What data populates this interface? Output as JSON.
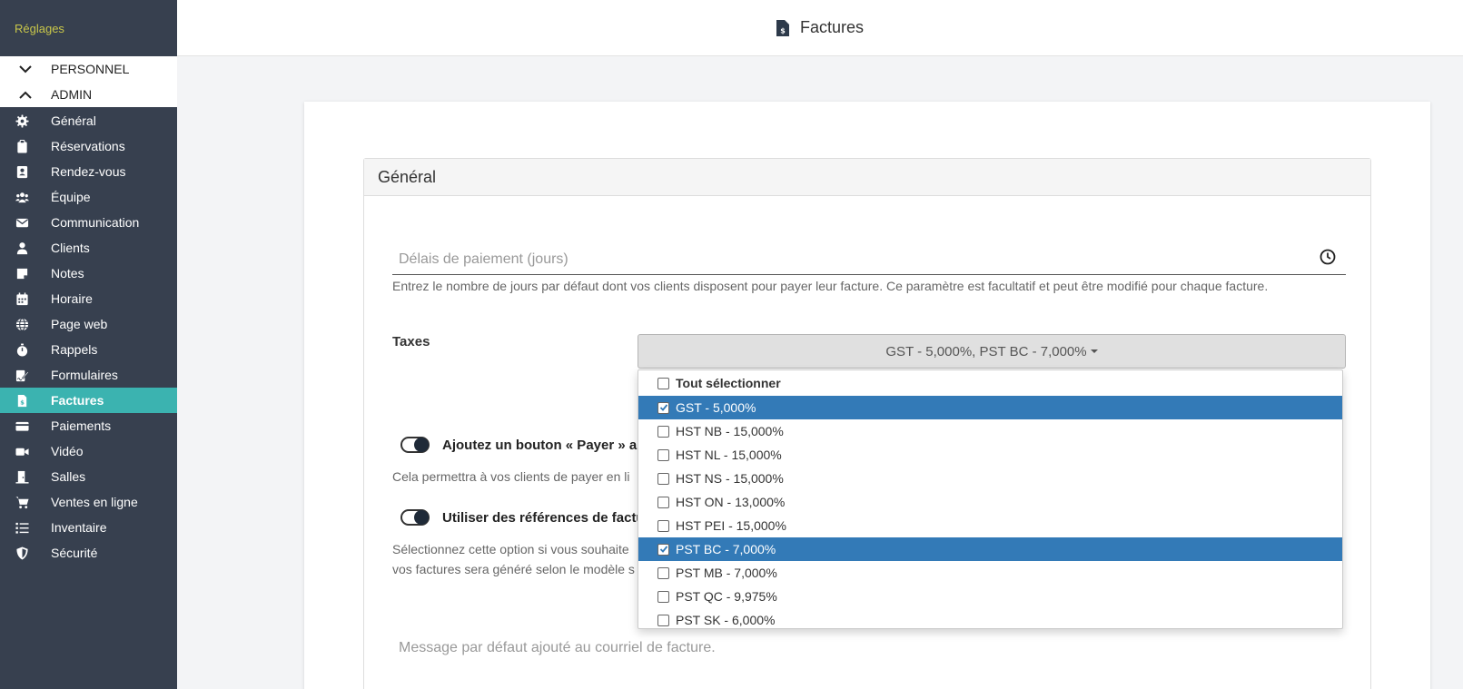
{
  "sidebar": {
    "heading": "Réglages",
    "sections": [
      {
        "label": "PERSONNEL",
        "state": "collapsed"
      },
      {
        "label": "ADMIN",
        "state": "expanded"
      }
    ],
    "items": [
      {
        "label": "Général",
        "icon": "gear-icon"
      },
      {
        "label": "Réservations",
        "icon": "clipboard-icon"
      },
      {
        "label": "Rendez-vous",
        "icon": "contact-card-icon"
      },
      {
        "label": "Équipe",
        "icon": "users-icon"
      },
      {
        "label": "Communication",
        "icon": "envelope-icon"
      },
      {
        "label": "Clients",
        "icon": "user-icon"
      },
      {
        "label": "Notes",
        "icon": "sticky-note-icon"
      },
      {
        "label": "Horaire",
        "icon": "calendar-icon"
      },
      {
        "label": "Page web",
        "icon": "globe-icon"
      },
      {
        "label": "Rappels",
        "icon": "stopwatch-icon"
      },
      {
        "label": "Formulaires",
        "icon": "signature-icon"
      },
      {
        "label": "Factures",
        "icon": "invoice-icon",
        "active": true
      },
      {
        "label": "Paiements",
        "icon": "credit-card-icon"
      },
      {
        "label": "Vidéo",
        "icon": "video-icon"
      },
      {
        "label": "Salles",
        "icon": "door-icon"
      },
      {
        "label": "Ventes en ligne",
        "icon": "cart-icon"
      },
      {
        "label": "Inventaire",
        "icon": "list-icon"
      },
      {
        "label": "Sécurité",
        "icon": "shield-icon"
      }
    ]
  },
  "header": {
    "title": "Factures",
    "icon": "invoice-icon"
  },
  "panel": {
    "title": "Général",
    "payment_delay": {
      "placeholder": "Délais de paiement (jours)",
      "value": "",
      "help": "Entrez le nombre de jours par défaut dont vos clients disposent pour payer leur facture. Ce paramètre est facultatif et peut être modifié pour chaque facture."
    },
    "taxes": {
      "label": "Taxes",
      "selected_text": "GST - 5,000%, PST BC - 7,000%"
    },
    "pay_button_toggle": {
      "label": "Ajoutez un bouton « Payer » aux",
      "help": "Cela permettra à vos clients de payer en li",
      "enabled": true
    },
    "invoice_ref_toggle": {
      "label": "Utiliser des références de factu",
      "help_line1": "Sélectionnez cette option si vous souhaite",
      "help_line2": "vos factures sera généré selon le modèle s",
      "enabled": true
    },
    "email_message": {
      "placeholder": "Message par défaut ajouté au courriel de facture."
    }
  },
  "tax_dropdown": {
    "select_all_label": "Tout sélectionner",
    "options": [
      {
        "label": "GST - 5,000%",
        "checked": true
      },
      {
        "label": "HST NB - 15,000%",
        "checked": false
      },
      {
        "label": "HST NL - 15,000%",
        "checked": false
      },
      {
        "label": "HST NS - 15,000%",
        "checked": false
      },
      {
        "label": "HST ON - 13,000%",
        "checked": false
      },
      {
        "label": "HST PEI - 15,000%",
        "checked": false
      },
      {
        "label": "PST BC - 7,000%",
        "checked": true
      },
      {
        "label": "PST MB - 7,000%",
        "checked": false
      },
      {
        "label": "PST QC - 9,975%",
        "checked": false
      },
      {
        "label": "PST SK - 6,000%",
        "checked": false
      }
    ]
  },
  "colors": {
    "sidebar_bg": "#37404f",
    "active_item": "#3bb3b0",
    "heading": "#c8c64a",
    "selection": "#337ab7"
  }
}
